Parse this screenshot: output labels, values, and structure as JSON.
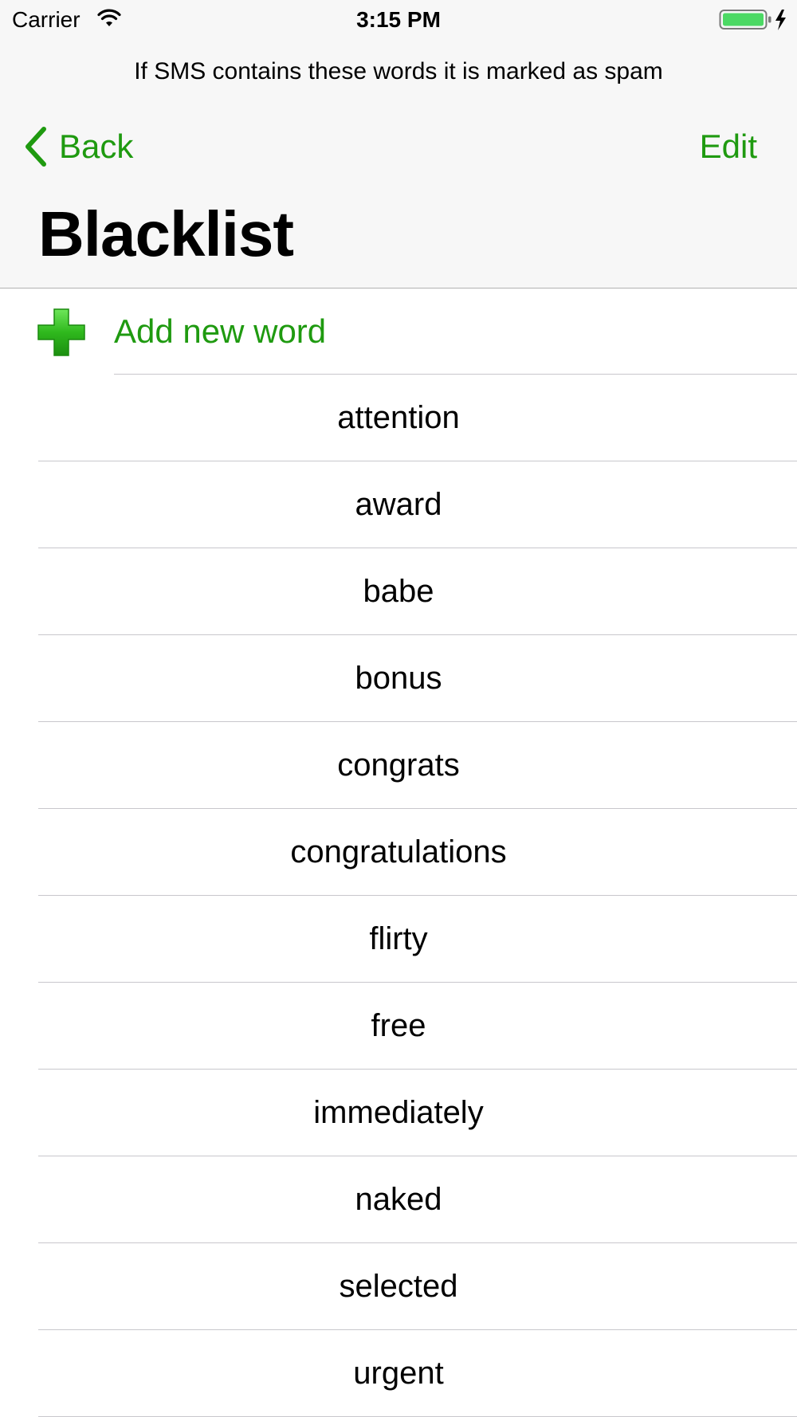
{
  "status_bar": {
    "carrier": "Carrier",
    "time": "3:15 PM",
    "battery_color": "#4cd964"
  },
  "header": {
    "prompt": "If SMS contains these words it is marked as spam",
    "back_label": "Back",
    "edit_label": "Edit",
    "title": "Blacklist"
  },
  "accent_color": "#1f9a10",
  "add_row": {
    "label": "Add new word",
    "icon": "plus-icon"
  },
  "words": [
    "attention",
    "award",
    "babe",
    "bonus",
    "congrats",
    "congratulations",
    "flirty",
    "free",
    "immediately",
    "naked",
    "selected",
    "urgent"
  ]
}
